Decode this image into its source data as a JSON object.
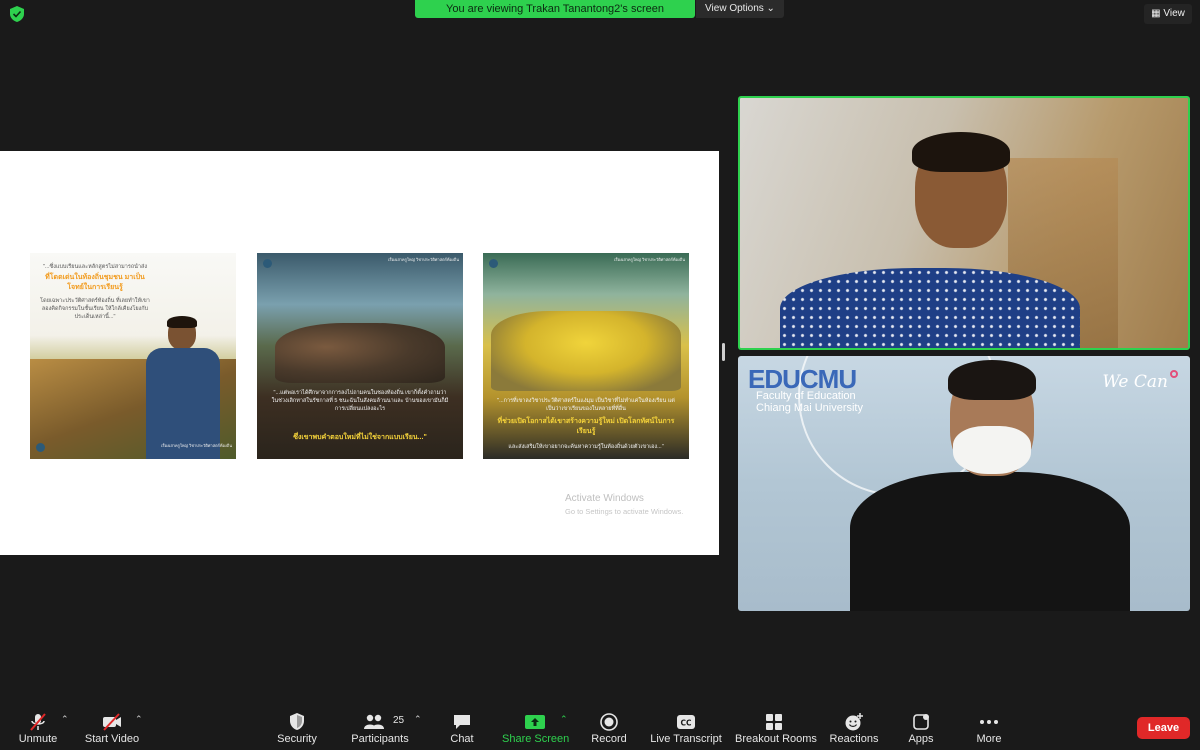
{
  "banner": {
    "viewing": "You are viewing Trakan Tanantong2's screen",
    "view_options": "View Options ⌄",
    "view": "View"
  },
  "slide": {
    "posts": [
      {
        "quote_top": "\"...ซึ่งแบบเรียนและหลักสูตรไม่สามารถนำส่ง",
        "highlight": "ที่โดดเด่นในท้องถิ่นชุมชน มาเป็นโจทย์ในการเรียนรู้",
        "quote_bottom": "โดยเฉพาะประวัติศาสตร์ท้องถิ่น ที่เลยทำให้เขาลองคิดกิจกรรมในชั้นเรียน ให้ใกล้เคียงโยงกับประเด็นเหล่านี้...\"",
        "caption": "เรื่องเล่าครูใหญ่ วิชาประวัติศาสตร์ท้องถิ่น"
      },
      {
        "quote_top": "\"...แต่พอเราได้ศึกษาจากการลงไปถามคนในชองท้องถิ่น เขาก็ตั้งคำถามว่าในช่วงเลิกทาสในรัชกาลที่ 5 ชนะฉันในสังคมล้านนาและ บ้านของเขามันก็มีการเปลี่ยนแปลงอะไร",
        "highlight": "ซึ่งเขาพบคำตอบใหม่ที่ไม่ใช่จากแบบเรียน...\"",
        "quote_bottom": "",
        "caption": "เรื่องเล่าครูใหญ่ วิชาประวัติศาสตร์ท้องถิ่น"
      },
      {
        "quote_top": "\"...การที่เขาลงวิชาประวัติศาสตร์ในแง่มุม เป็นวิชาที่ไม่ทำแค่ในห้องเรียน แต่เป็นว่าเขาเรียนของในหลายที่ที่อื่น",
        "highlight": "ที่ช่วยเปิดโอกาสได้เขาสร้างความรู้ใหม่ เปิดโลกทัศน์ในการเรียนรู้",
        "quote_bottom": "และส่งเสริมให้เขาอยากจะค้นหาความรู้ในท้องถิ่นด้วยตัวเขาเอง...\"",
        "caption": "เรื่องเล่าครูใหญ่ วิชาประวัติศาสตร์ท้องถิ่น"
      }
    ],
    "watermark": "Activate Windows",
    "watermark_sub": "Go to Settings to activate Windows."
  },
  "video2": {
    "brand": "EDUCMU",
    "faculty_line1": "Faculty of Education",
    "faculty_line2": "Chiang Mai University",
    "slogan": "We Can"
  },
  "toolbar": {
    "unmute": "Unmute",
    "start_video": "Start Video",
    "security": "Security",
    "participants": "Participants",
    "participants_count": "25",
    "chat": "Chat",
    "share_screen": "Share Screen",
    "record": "Record",
    "live_transcript": "Live Transcript",
    "breakout_rooms": "Breakout Rooms",
    "reactions": "Reactions",
    "apps": "Apps",
    "more": "More",
    "leave": "Leave"
  },
  "colors": {
    "accent_green": "#2ed14e",
    "leave_red": "#e02828",
    "highlight_orange": "#f29a1c",
    "highlight_yellow": "#f4d23a"
  }
}
